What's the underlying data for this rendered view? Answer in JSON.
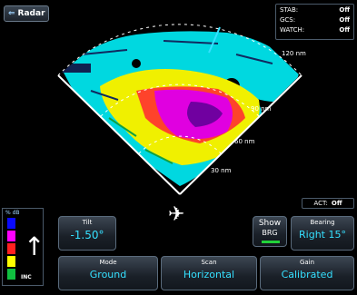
{
  "header": {
    "back_label": "Radar",
    "back_icon": "back-arrow-icon"
  },
  "status": {
    "rows": [
      {
        "label": "STAB:",
        "value": "Off"
      },
      {
        "label": "GCS:",
        "value": "Off"
      },
      {
        "label": "WATCH:",
        "value": "Off"
      }
    ]
  },
  "ranges": {
    "r120": "120 nm",
    "r90": "90 nm",
    "r60": "60 nm",
    "r30": "30 nm"
  },
  "scale": {
    "title": "% dB",
    "inc": "INC",
    "colors": [
      "#0a0aff",
      "#ff00ff",
      "#ff2020",
      "#ffff00",
      "#10c040"
    ]
  },
  "act": {
    "label": "ACT:",
    "value": "Off"
  },
  "tilt": {
    "label": "Tilt",
    "value": "-1.50°"
  },
  "show_brg": {
    "line1": "Show",
    "line2": "BRG"
  },
  "bearing": {
    "label": "Bearing",
    "value": "Right 15°"
  },
  "mode": {
    "label": "Mode",
    "value": "Ground"
  },
  "scan": {
    "label": "Scan",
    "value": "Horizontal"
  },
  "gain": {
    "label": "Gain",
    "value": "Calibrated"
  },
  "colors": {
    "accent": "#35e0ff",
    "cyan_return": "#00d8e0",
    "yellow_return": "#f0f000",
    "magenta_return": "#e000e0"
  }
}
